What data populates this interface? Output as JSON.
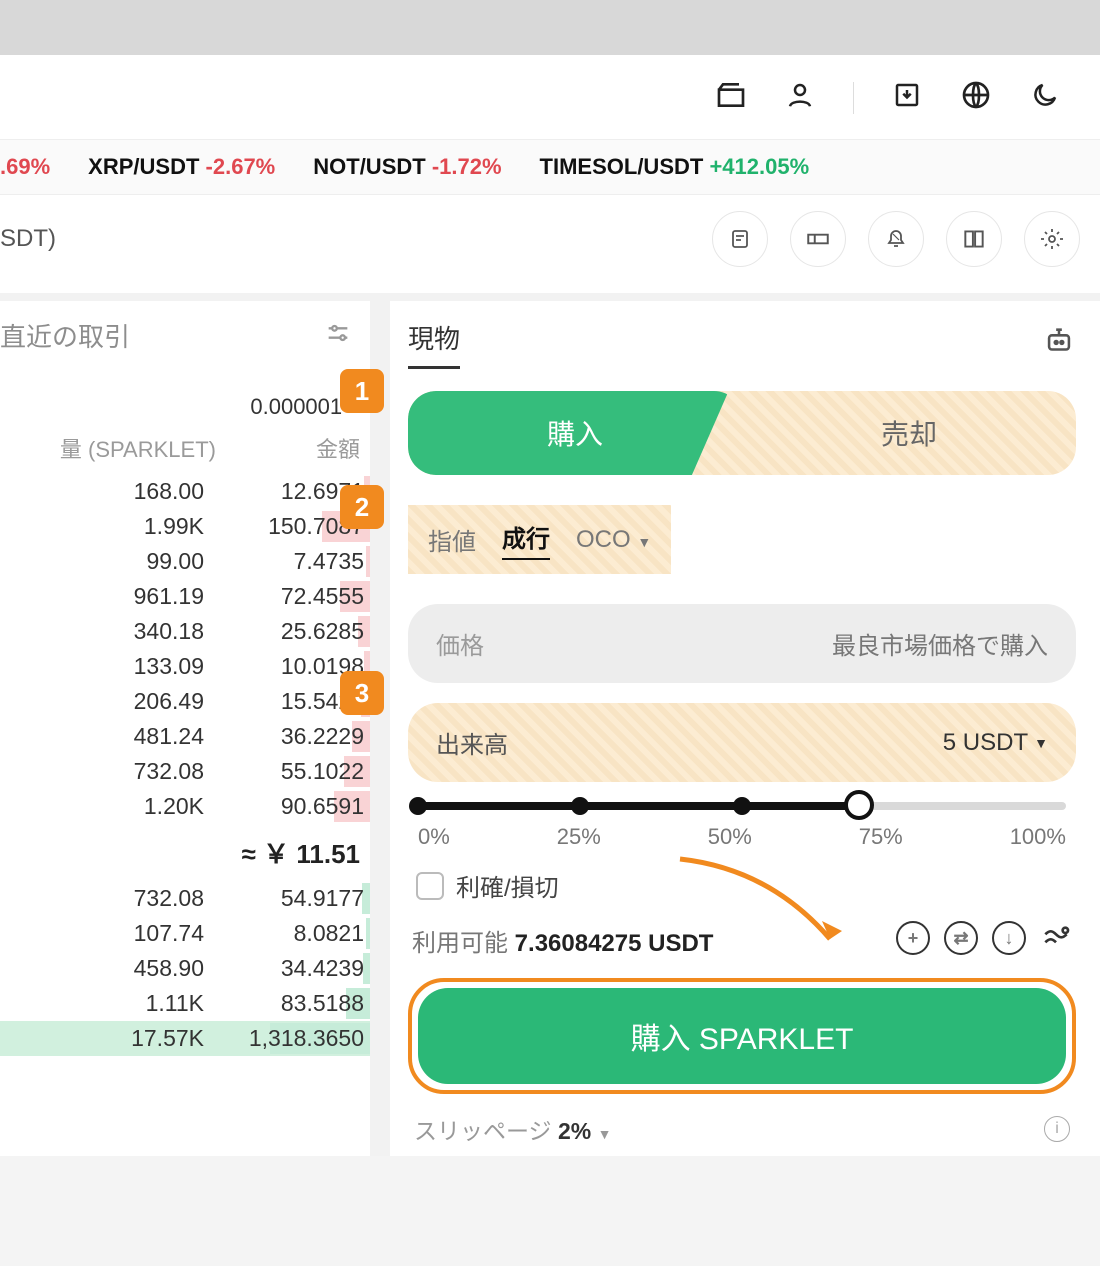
{
  "ticker": [
    {
      "pair_suffix": ".69%",
      "change": "",
      "cls": "neg",
      "partial": true
    },
    {
      "pair": "XRP/USDT",
      "change": "-2.67%",
      "cls": "neg"
    },
    {
      "pair": "NOT/USDT",
      "change": "-1.72%",
      "cls": "neg"
    },
    {
      "pair": "TIMESOL/USDT",
      "change": "+412.05%",
      "cls": "pos"
    }
  ],
  "pair_label_suffix": "SDT)",
  "left": {
    "title": "直近の取引",
    "precision": "0.000001",
    "qty_header": "量 (SPARKLET)",
    "amt_header": "金額",
    "sells": [
      {
        "qty": "168.00",
        "amt": "12.6971",
        "bar": 6
      },
      {
        "qty": "1.99K",
        "amt": "150.7087",
        "bar": 48
      },
      {
        "qty": "99.00",
        "amt": "7.4735",
        "bar": 4
      },
      {
        "qty": "961.19",
        "amt": "72.4555",
        "bar": 30
      },
      {
        "qty": "340.18",
        "amt": "25.6285",
        "bar": 12
      },
      {
        "qty": "133.09",
        "amt": "10.0198",
        "bar": 6
      },
      {
        "qty": "206.49",
        "amt": "15.5427",
        "bar": 9
      },
      {
        "qty": "481.24",
        "amt": "36.2229",
        "bar": 18
      },
      {
        "qty": "732.08",
        "amt": "55.1022",
        "bar": 26
      },
      {
        "qty": "1.20K",
        "amt": "90.6591",
        "bar": 36
      }
    ],
    "mid_price": "≈ ￥ 11.51",
    "buys": [
      {
        "qty": "732.08",
        "amt": "54.9177",
        "bar": 8
      },
      {
        "qty": "107.74",
        "amt": "8.0821",
        "bar": 4
      },
      {
        "qty": "458.90",
        "amt": "34.4239",
        "bar": 7
      },
      {
        "qty": "1.11K",
        "amt": "83.5188",
        "bar": 24
      },
      {
        "qty": "17.57K",
        "amt": "1,318.3650",
        "bar": 100,
        "highlight": true
      }
    ]
  },
  "order": {
    "tab": "現物",
    "buy": "購入",
    "sell": "売却",
    "types": {
      "limit": "指値",
      "market": "成行",
      "oco": "OCO"
    },
    "price_label": "価格",
    "price_placeholder": "最良市場価格で購入",
    "volume_label": "出来高",
    "volume_value": "5 USDT",
    "slider": {
      "pct": 68,
      "labels": [
        "0%",
        "25%",
        "50%",
        "75%",
        "100%"
      ]
    },
    "tpsl": "利確/損切",
    "available_label": "利用可能",
    "available_value": "7.36084275 USDT",
    "buy_button": "購入 SPARKLET",
    "slippage_label": "スリッページ",
    "slippage_value": "2%"
  },
  "callouts": [
    "1",
    "2",
    "3"
  ]
}
